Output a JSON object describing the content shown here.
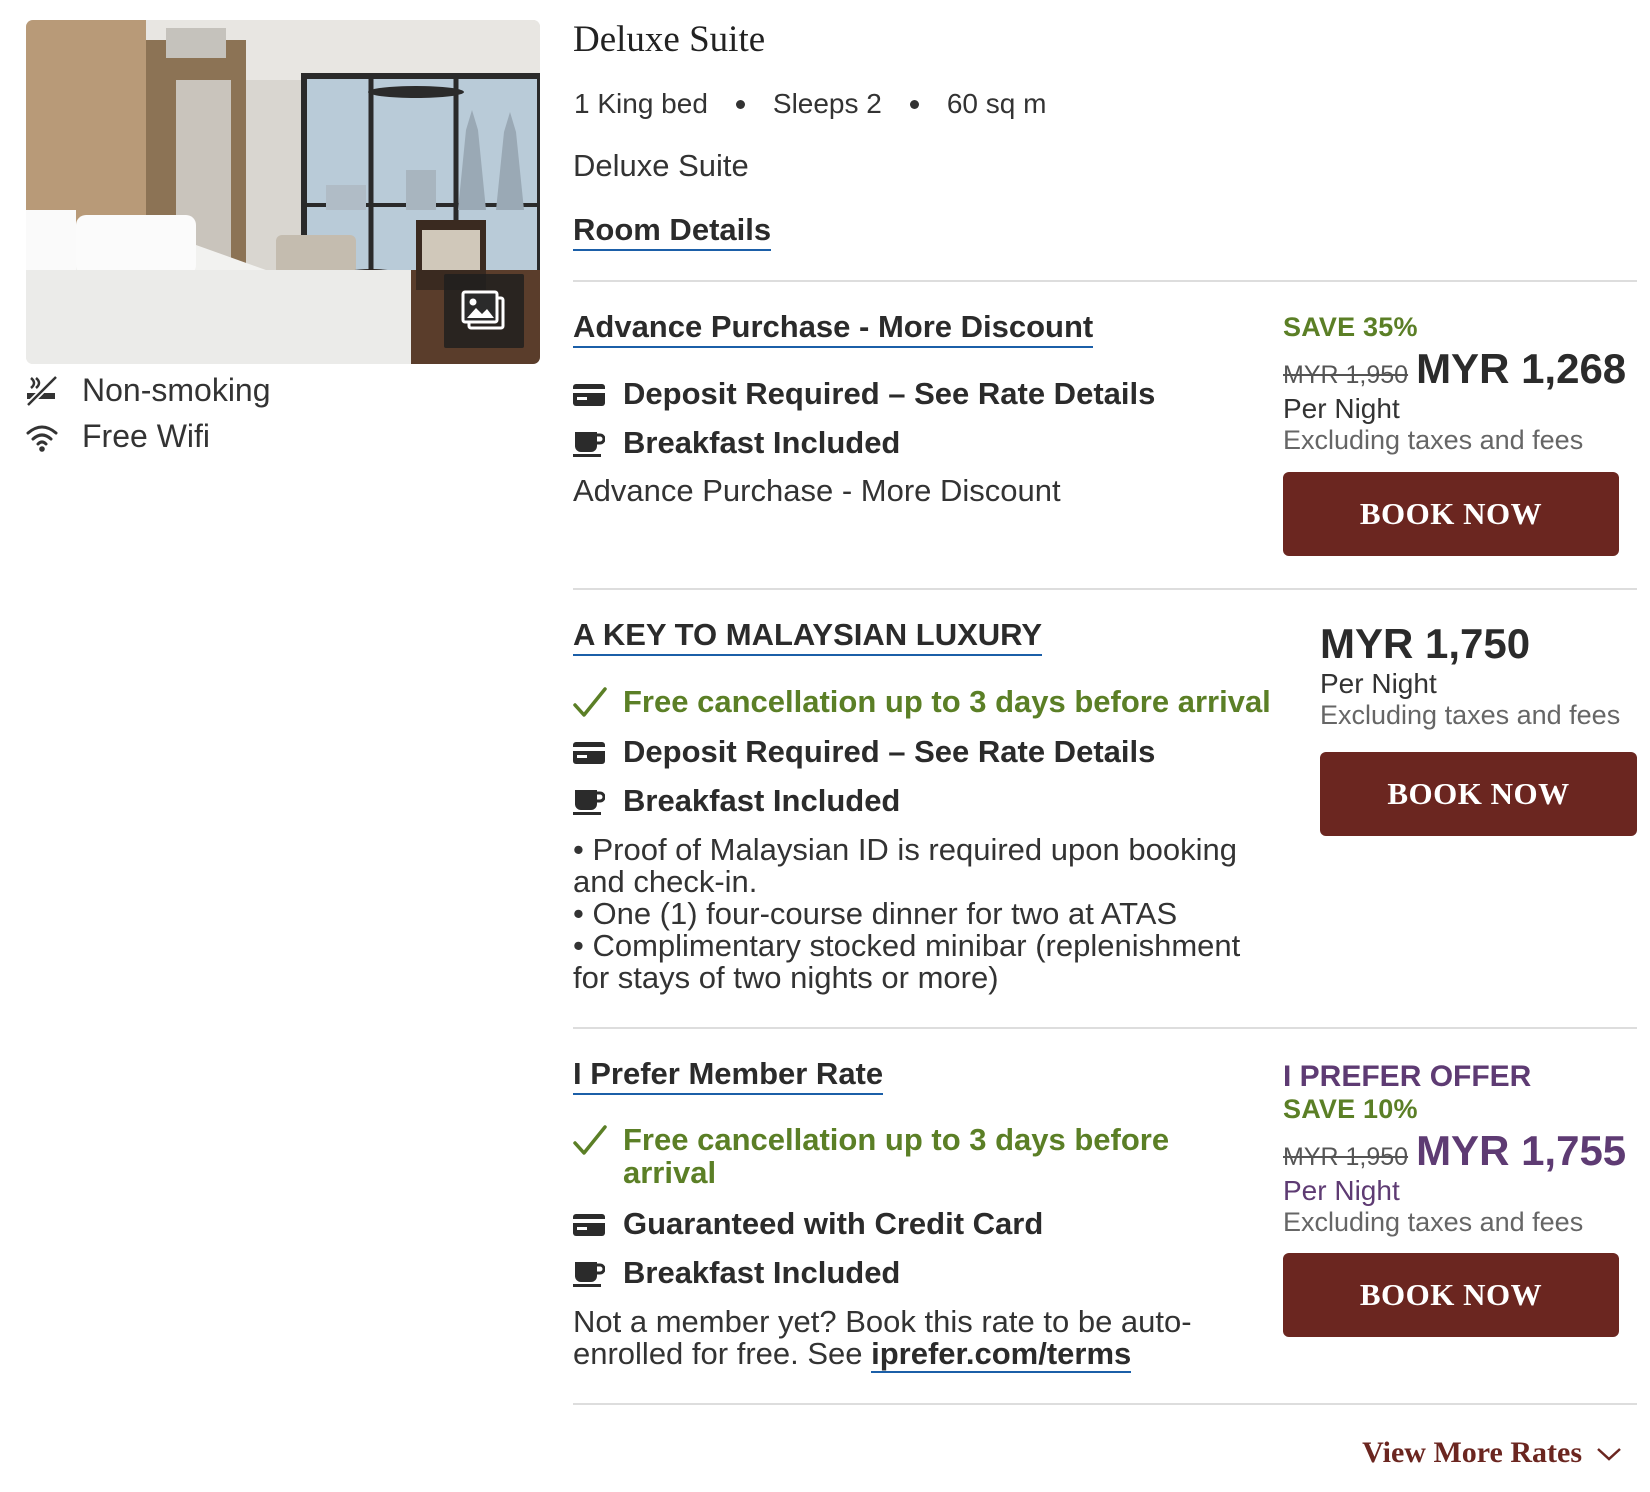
{
  "room": {
    "title": "Deluxe Suite",
    "bed": "1 King bed",
    "sleeps": "Sleeps 2",
    "size": "60 sq m",
    "description": "Deluxe Suite",
    "details_link": "Room Details",
    "photo_icon": "gallery-icon"
  },
  "amenities": [
    {
      "label": "Non-smoking",
      "icon": "no-smoking-icon"
    },
    {
      "label": "Free Wifi",
      "icon": "wifi-icon"
    }
  ],
  "rates": [
    {
      "name": "Advance Purchase - More Discount",
      "features": [
        {
          "icon": "credit-card-icon",
          "text": "Deposit Required – See Rate Details"
        },
        {
          "icon": "coffee-cup-icon",
          "text": "Breakfast Included"
        }
      ],
      "description": "Advance Purchase - More Discount",
      "save": "SAVE 35%",
      "was_price": "MYR 1,950",
      "price": "MYR 1,268",
      "per_night": "Per Night",
      "excl": "Excluding taxes and fees",
      "book": "BOOK NOW"
    },
    {
      "name": "A KEY TO MALAYSIAN LUXURY",
      "features": [
        {
          "icon": "checkmark-icon",
          "text": "Free cancellation up to 3 days before arrival"
        },
        {
          "icon": "credit-card-icon",
          "text": "Deposit Required – See Rate Details"
        },
        {
          "icon": "coffee-cup-icon",
          "text": "Breakfast Included"
        }
      ],
      "notes": [
        "• Proof of Malaysian ID is required upon booking",
        "and check-in.",
        "• One (1) four-course dinner for two at ATAS",
        "• Complimentary stocked minibar (replenishment",
        "for stays of two nights or more)"
      ],
      "price": "MYR 1,750",
      "per_night": "Per Night",
      "excl": "Excluding taxes and fees",
      "book": "BOOK NOW"
    },
    {
      "name": "I Prefer Member Rate",
      "features": [
        {
          "icon": "checkmark-icon",
          "text_line1": "Free cancellation up to 3 days before",
          "text_line2": "arrival"
        },
        {
          "icon": "credit-card-icon",
          "text": "Guaranteed with Credit Card"
        },
        {
          "icon": "coffee-cup-icon",
          "text": "Breakfast Included"
        }
      ],
      "note_line1": "Not a member yet? Book this rate to be auto-",
      "note_line2_prefix": "enrolled for free. See ",
      "note_link": "iprefer.com/terms",
      "offer": "I PREFER OFFER",
      "save": "SAVE 10%",
      "was_price": "MYR 1,950",
      "price": "MYR 1,755",
      "per_night": "Per Night",
      "excl": "Excluding taxes and fees",
      "book": "BOOK NOW"
    }
  ],
  "view_more": {
    "label": "View More Rates",
    "icon": "chevron-down-icon"
  },
  "colors": {
    "book_button": "#6b2620",
    "save_green": "#5b7f26",
    "iprefer_purple": "#5e3b73",
    "link_underline": "#1b5fa8"
  }
}
